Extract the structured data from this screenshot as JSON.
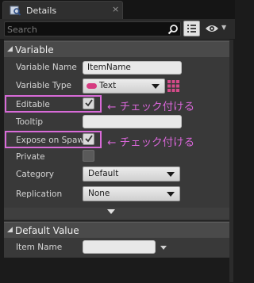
{
  "tab": {
    "title": "Details",
    "close": "×"
  },
  "search": {
    "placeholder": "Search",
    "value": ""
  },
  "variable_category": {
    "title": "Variable",
    "rows": {
      "variable_name": {
        "label": "Variable Name",
        "value": "ItemName"
      },
      "variable_type": {
        "label": "Variable Type",
        "value": "Text",
        "pin_color": "#d63b80"
      },
      "editable": {
        "label": "Editable",
        "checked": true
      },
      "tooltip": {
        "label": "Tooltip",
        "value": ""
      },
      "expose_on_spawn": {
        "label": "Expose on Spaw",
        "checked": true
      },
      "private": {
        "label": "Private",
        "checked": false
      },
      "category": {
        "label": "Category",
        "value": "Default"
      },
      "replication": {
        "label": "Replication",
        "value": "None"
      }
    }
  },
  "default_value_category": {
    "title": "Default Value",
    "rows": {
      "item_name": {
        "label": "Item Name",
        "value": ""
      }
    }
  },
  "annotations": {
    "editable_note": "← チェック付ける",
    "expose_note": "← チェック付ける",
    "color": "#d866d8"
  },
  "icons": {
    "tab": "details-icon",
    "search": "search-icon",
    "view": "grid-view-icon",
    "visibility": "eye-icon",
    "checkbox": "checkmark-icon"
  }
}
